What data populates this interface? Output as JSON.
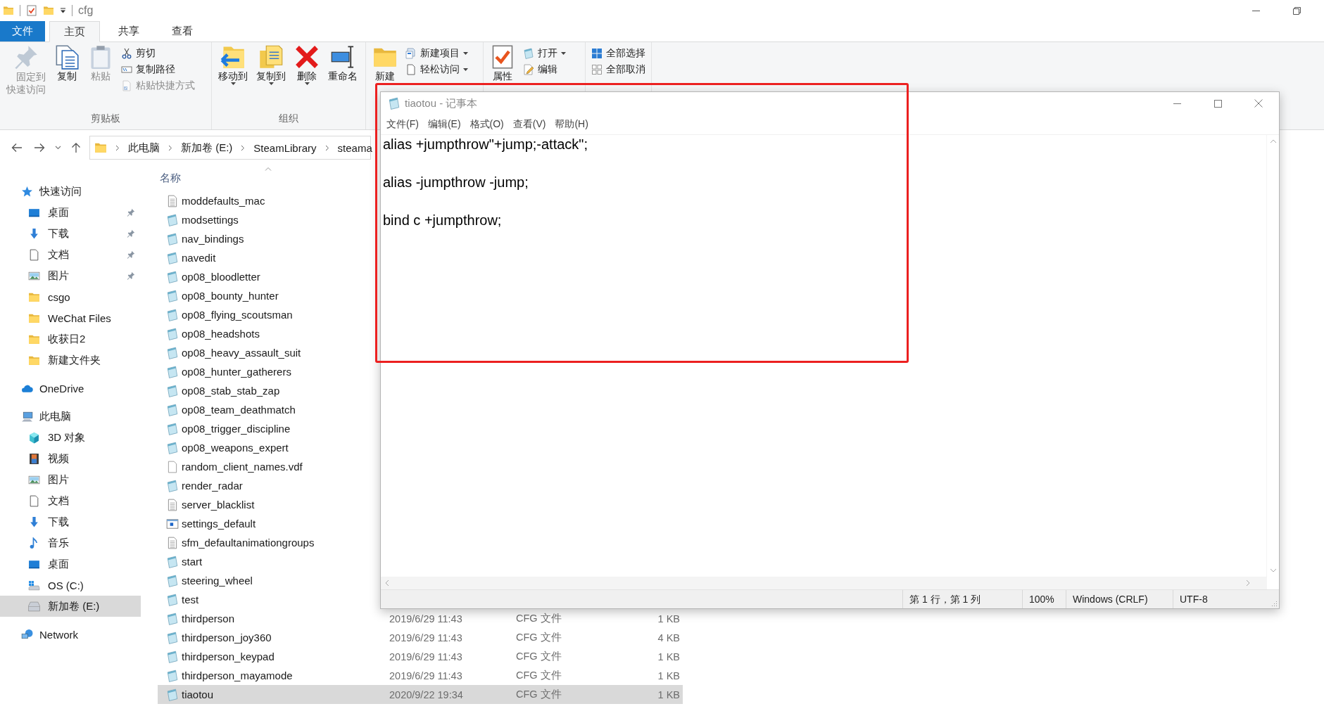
{
  "window": {
    "title": "cfg"
  },
  "tabs": [
    {
      "label": "文件",
      "kind": "file",
      "selected": false
    },
    {
      "label": "主页",
      "kind": "tab",
      "selected": true
    },
    {
      "label": "共享",
      "kind": "tab",
      "selected": false
    },
    {
      "label": "查看",
      "kind": "tab",
      "selected": false
    }
  ],
  "ribbon": {
    "groups": [
      {
        "label": "剪贴板",
        "buttons": [
          {
            "label": "固定到快速访问",
            "kind": "large",
            "disabled": true,
            "dropdown": false
          },
          {
            "label": "复制",
            "kind": "large",
            "disabled": false,
            "dropdown": false
          },
          {
            "label": "粘贴",
            "kind": "large",
            "disabled": true,
            "dropdown": false
          },
          {
            "label": "剪切",
            "kind": "small",
            "disabled": false,
            "dropdown": false
          },
          {
            "label": "复制路径",
            "kind": "small",
            "disabled": false,
            "dropdown": false
          },
          {
            "label": "粘贴快捷方式",
            "kind": "small",
            "disabled": true,
            "dropdown": false
          }
        ]
      },
      {
        "label": "组织",
        "buttons": [
          {
            "label": "移动到",
            "kind": "large",
            "disabled": false,
            "dropdown": true
          },
          {
            "label": "复制到",
            "kind": "large",
            "disabled": false,
            "dropdown": true
          },
          {
            "label": "删除",
            "kind": "large",
            "disabled": false,
            "dropdown": true
          },
          {
            "label": "重命名",
            "kind": "large",
            "disabled": false,
            "dropdown": false
          }
        ]
      },
      {
        "buttons": [
          {
            "label": "新建",
            "kind": "large",
            "disabled": false,
            "dropdown": false
          },
          {
            "label": "新建项目",
            "kind": "small",
            "disabled": false,
            "dropdown": true
          },
          {
            "label": "轻松访问",
            "kind": "small",
            "disabled": false,
            "dropdown": true
          }
        ]
      },
      {
        "buttons": [
          {
            "label": "属性",
            "kind": "large",
            "disabled": false,
            "dropdown": false
          },
          {
            "label": "打开",
            "kind": "small",
            "disabled": false,
            "dropdown": true
          },
          {
            "label": "编辑",
            "kind": "small",
            "disabled": false,
            "dropdown": false
          }
        ]
      },
      {
        "buttons": [
          {
            "label": "全部选择",
            "kind": "small",
            "disabled": false,
            "dropdown": false
          },
          {
            "label": "全部取消",
            "kind": "small",
            "disabled": false,
            "dropdown": false
          }
        ]
      }
    ]
  },
  "address_bar": {
    "segments": [
      "此电脑",
      "新加卷 (E:)",
      "SteamLibrary",
      "steama"
    ]
  },
  "sidebar": {
    "items": [
      {
        "label": "快速访问",
        "kind": "star",
        "selected": false,
        "children": [
          {
            "label": "桌面",
            "kind": "desktop",
            "pinned": true,
            "selected": false
          },
          {
            "label": "下载",
            "kind": "download",
            "pinned": true,
            "selected": false
          },
          {
            "label": "文档",
            "kind": "document",
            "pinned": true,
            "selected": false
          },
          {
            "label": "图片",
            "kind": "picture",
            "pinned": true,
            "selected": false
          },
          {
            "label": "csgo",
            "kind": "folder",
            "pinned": false,
            "selected": false
          },
          {
            "label": "WeChat Files",
            "kind": "folder",
            "pinned": false,
            "selected": false
          },
          {
            "label": "收获日2",
            "kind": "folder",
            "pinned": false,
            "selected": false
          },
          {
            "label": "新建文件夹",
            "kind": "folder",
            "pinned": false,
            "selected": false
          }
        ]
      },
      {
        "label": "OneDrive",
        "kind": "cloud",
        "selected": false
      },
      {
        "label": "此电脑",
        "kind": "computer",
        "selected": false,
        "children": [
          {
            "label": "3D 对象",
            "kind": "cube",
            "selected": false
          },
          {
            "label": "视频",
            "kind": "film",
            "selected": false
          },
          {
            "label": "图片",
            "kind": "picture",
            "selected": false
          },
          {
            "label": "文档",
            "kind": "document",
            "selected": false
          },
          {
            "label": "下载",
            "kind": "download",
            "selected": false
          },
          {
            "label": "音乐",
            "kind": "music",
            "selected": false
          },
          {
            "label": "桌面",
            "kind": "desktop",
            "selected": false
          },
          {
            "label": "OS (C:)",
            "kind": "windows-drive",
            "selected": false
          },
          {
            "label": "新加卷 (E:)",
            "kind": "drive",
            "selected": true
          }
        ]
      },
      {
        "label": "Network",
        "kind": "network",
        "selected": false
      }
    ]
  },
  "file_list": {
    "columns": [
      "名称"
    ],
    "rows": [
      {
        "name": "moddefaults_mac",
        "kind": "text",
        "selected": false
      },
      {
        "name": "modsettings",
        "kind": "cfg",
        "selected": false
      },
      {
        "name": "nav_bindings",
        "kind": "cfg",
        "selected": false
      },
      {
        "name": "navedit",
        "kind": "cfg",
        "selected": false
      },
      {
        "name": "op08_bloodletter",
        "kind": "cfg",
        "selected": false
      },
      {
        "name": "op08_bounty_hunter",
        "kind": "cfg",
        "selected": false
      },
      {
        "name": "op08_flying_scoutsman",
        "kind": "cfg",
        "selected": false
      },
      {
        "name": "op08_headshots",
        "kind": "cfg",
        "selected": false
      },
      {
        "name": "op08_heavy_assault_suit",
        "kind": "cfg",
        "selected": false
      },
      {
        "name": "op08_hunter_gatherers",
        "kind": "cfg",
        "selected": false
      },
      {
        "name": "op08_stab_stab_zap",
        "kind": "cfg",
        "selected": false
      },
      {
        "name": "op08_team_deathmatch",
        "kind": "cfg",
        "selected": false
      },
      {
        "name": "op08_trigger_discipline",
        "kind": "cfg",
        "selected": false
      },
      {
        "name": "op08_weapons_expert",
        "kind": "cfg",
        "selected": false
      },
      {
        "name": "random_client_names.vdf",
        "kind": "blank",
        "selected": false
      },
      {
        "name": "render_radar",
        "kind": "cfg",
        "selected": false
      },
      {
        "name": "server_blacklist",
        "kind": "text",
        "selected": false
      },
      {
        "name": "settings_default",
        "kind": "settings",
        "selected": false
      },
      {
        "name": "sfm_defaultanimationgroups",
        "kind": "text",
        "selected": false
      },
      {
        "name": "start",
        "kind": "cfg",
        "selected": false
      },
      {
        "name": "steering_wheel",
        "kind": "cfg",
        "selected": false
      },
      {
        "name": "test",
        "kind": "cfg",
        "selected": false
      },
      {
        "name": "thirdperson",
        "kind": "cfg",
        "selected": false,
        "date": "2019/6/29 11:43",
        "type": "CFG 文件",
        "size": "1 KB"
      },
      {
        "name": "thirdperson_joy360",
        "kind": "cfg",
        "selected": false,
        "date": "2019/6/29 11:43",
        "type": "CFG 文件",
        "size": "4 KB"
      },
      {
        "name": "thirdperson_keypad",
        "kind": "cfg",
        "selected": false,
        "date": "2019/6/29 11:43",
        "type": "CFG 文件",
        "size": "1 KB"
      },
      {
        "name": "thirdperson_mayamode",
        "kind": "cfg",
        "selected": false,
        "date": "2019/6/29 11:43",
        "type": "CFG 文件",
        "size": "1 KB"
      },
      {
        "name": "tiaotou",
        "kind": "cfg",
        "selected": true,
        "date": "2020/9/22 19:34",
        "type": "CFG 文件",
        "size": "1 KB"
      }
    ]
  },
  "notepad": {
    "title": "tiaotou - 记事本",
    "menu": [
      "文件(F)",
      "编辑(E)",
      "格式(O)",
      "查看(V)",
      "帮助(H)"
    ],
    "content": "alias +jumpthrow\"+jump;-attack\";\n\nalias -jumpthrow -jump;\n\nbind c +jumpthrow;",
    "status_bar": [
      "第 1 行，第 1 列",
      "100%",
      "Windows (CRLF)",
      "UTF-8"
    ]
  }
}
